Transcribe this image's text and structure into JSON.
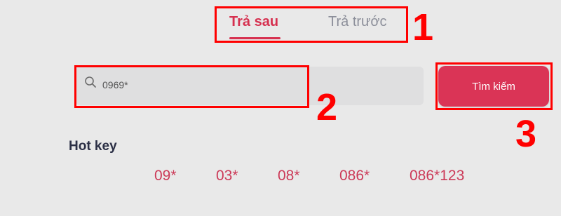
{
  "tabs": [
    {
      "label": "Trả sau",
      "active": true
    },
    {
      "label": "Trả trước",
      "active": false
    }
  ],
  "search": {
    "value": "0969*",
    "button_label": "Tìm kiếm"
  },
  "hotkeys": {
    "title": "Hot key",
    "items": [
      "09*",
      "03*",
      "08*",
      "086*",
      "086*123"
    ]
  },
  "annotations": {
    "labels": [
      "1",
      "2",
      "3"
    ],
    "color": "#ff0000"
  },
  "colors": {
    "accent": "#da3456",
    "background": "#e9e9e9"
  }
}
